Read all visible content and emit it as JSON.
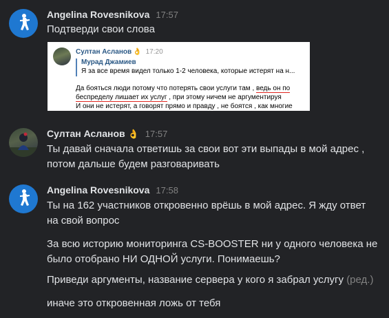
{
  "colors": {
    "background": "#222326",
    "avatar_blue": "#1f78d1",
    "text": "#e1e3e6",
    "muted": "#828282",
    "underline": "#e0241e",
    "link_blue": "#2a5885"
  },
  "messages": [
    {
      "author": "Angelina Rovesnikova",
      "time": "17:57",
      "avatar_icon": "soldier-silhouette-icon",
      "lines": [
        "Подтверди свои слова"
      ],
      "screenshot": {
        "author": "Султан Асланов",
        "emoji": "👌",
        "time": "17:20",
        "quote_author": "Мурад Джамиев",
        "quote_text": "Я за все время видел только 1-2 человека, которые истерят на н...",
        "body_line1_a": "Да бояться люди потому что потерять свои услуги там ,",
        "body_line1_b": "ведь он по",
        "body_line2_a": "беспределу лишает их услуг",
        "body_line2_b": ", при этому ничем не аргументируя",
        "body_line3": "И они не истерят, а говорят прямо и правду , не боятся , как многие"
      }
    },
    {
      "author": "Султан Асланов",
      "emoji": "👌",
      "time": "17:57",
      "avatar_icon": "user-photo-icon",
      "lines": [
        "Ты давай сначала ответишь за свои вот эти выпады в мой адрес ,",
        "потом дальше будем разговаривать"
      ]
    },
    {
      "author": "Angelina Rovesnikova",
      "time": "17:58",
      "avatar_icon": "soldier-silhouette-icon",
      "paragraphs": [
        [
          "Ты на 162 участников откровенно врёшь в мой адрес. Я жду ответ",
          "на свой вопрос"
        ],
        [
          "За всю историю мониторинга CS-BOOSTER ни у одного человека не",
          "было отобрано НИ ОДНОЙ услуги. Понимаешь?"
        ],
        [
          "Приведи аргументы, название сервера у кого я забрал услугу"
        ],
        [
          "иначе это откровенная ложь от тебя"
        ]
      ],
      "edited_label": "(ред.)"
    }
  ]
}
